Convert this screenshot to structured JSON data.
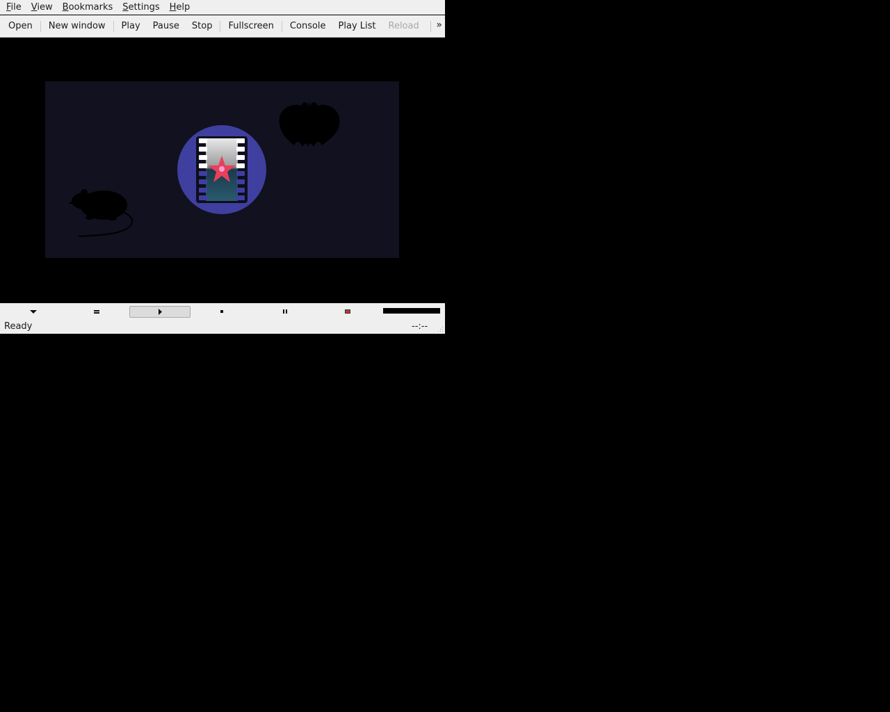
{
  "menubar": {
    "items": [
      {
        "label": "File",
        "mnemonic": "F",
        "rest": "ile"
      },
      {
        "label": "View",
        "mnemonic": "V",
        "rest": "iew"
      },
      {
        "label": "Bookmarks",
        "mnemonic": "B",
        "rest": "ookmarks"
      },
      {
        "label": "Settings",
        "mnemonic": "S",
        "rest": "ettings"
      },
      {
        "label": "Help",
        "mnemonic": "H",
        "rest": "elp"
      }
    ]
  },
  "toolbar": {
    "open": "Open",
    "new_window": "New window",
    "play": "Play",
    "pause": "Pause",
    "stop": "Stop",
    "fullscreen": "Fullscreen",
    "console": "Console",
    "playlist": "Play List",
    "reload": "Reload",
    "more": "»"
  },
  "controls": {
    "icons": [
      "menu-down-icon",
      "config-icon",
      "play-icon",
      "stop-icon",
      "pause-icon",
      "record-icon"
    ],
    "record_color": "#c0392b",
    "volume_level": 1.0
  },
  "status": {
    "text": "Ready",
    "time": "--:--"
  },
  "colors": {
    "logo_panel": "#11111f",
    "logo_circle": "#3f3fa0",
    "star": "#e8405a"
  }
}
